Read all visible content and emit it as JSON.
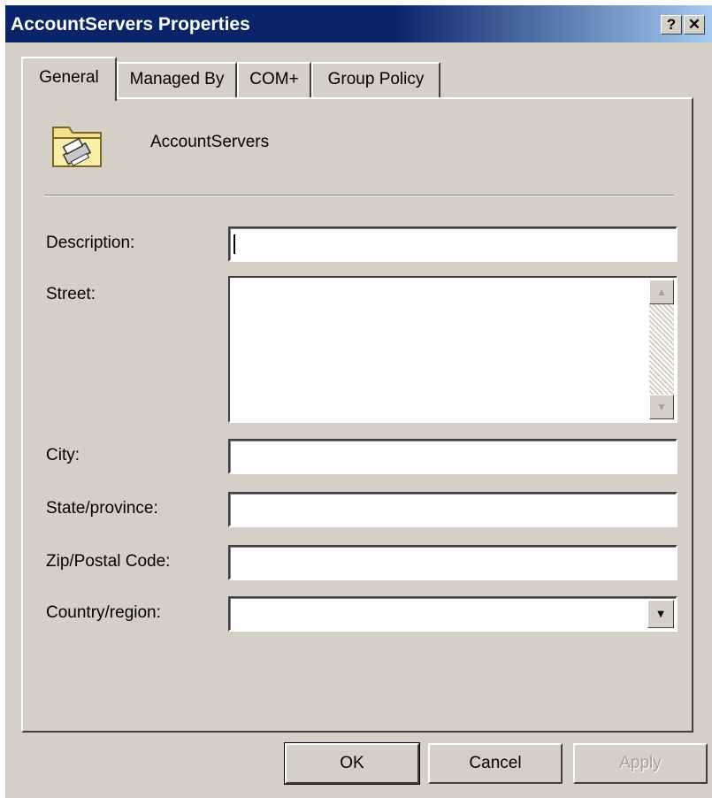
{
  "window": {
    "title": "AccountServers Properties",
    "help_button": "?",
    "close_button": "✕"
  },
  "tabs": [
    {
      "label": "General",
      "active": true
    },
    {
      "label": "Managed By",
      "active": false
    },
    {
      "label": "COM+",
      "active": false
    },
    {
      "label": "Group Policy",
      "active": false
    }
  ],
  "general": {
    "object_name": "AccountServers",
    "object_icon": "folder-icon",
    "fields": {
      "description": {
        "label": "Description:",
        "value": ""
      },
      "street": {
        "label": "Street:",
        "value": ""
      },
      "city": {
        "label": "City:",
        "value": ""
      },
      "state": {
        "label": "State/province:",
        "value": ""
      },
      "zip": {
        "label": "Zip/Postal Code:",
        "value": ""
      },
      "country": {
        "label": "Country/region:",
        "value": ""
      }
    }
  },
  "buttons": {
    "ok": "OK",
    "cancel": "Cancel",
    "apply": "Apply"
  },
  "colors": {
    "titlebar": "#0a246a",
    "face": "#d4d0c8"
  }
}
